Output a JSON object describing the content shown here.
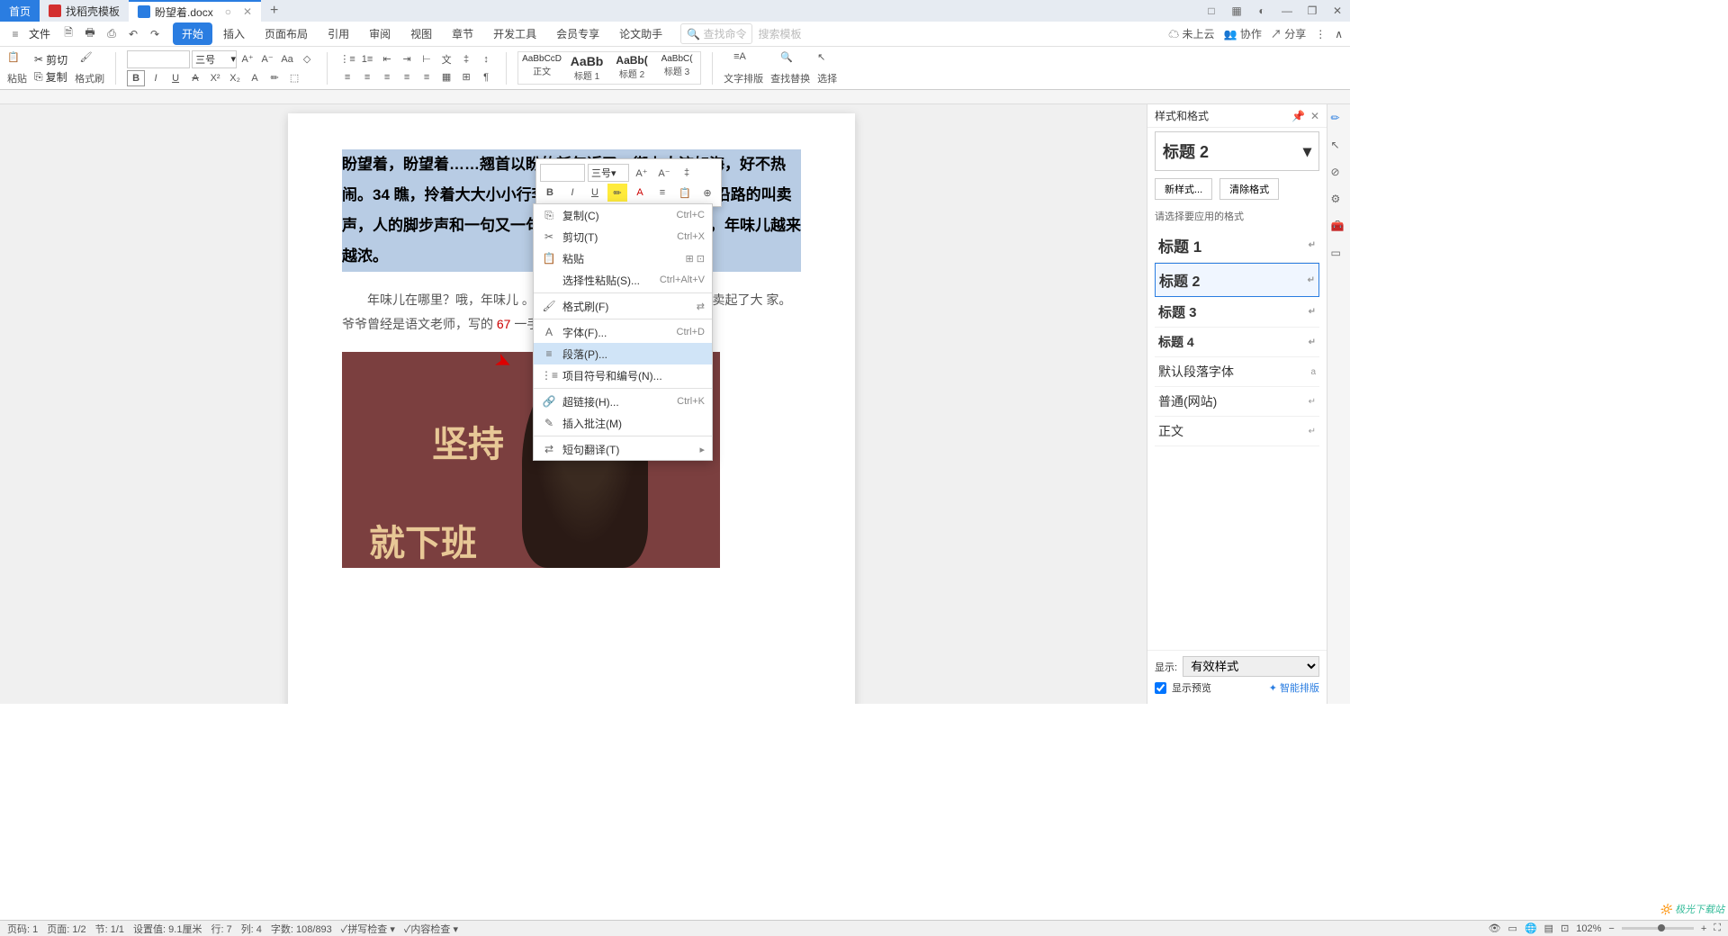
{
  "tabs": {
    "home": "首页",
    "template": "找稻壳模板",
    "doc": "盼望着.docx",
    "plus": "+"
  },
  "window": {
    "close": "✕",
    "max": "❐",
    "min": "—",
    "restore": "□",
    "grid": "▦"
  },
  "file_menu": "文件",
  "qat": [
    "▢",
    "🖶",
    "⎙",
    "↺",
    "↻"
  ],
  "ribbon_tabs": [
    "开始",
    "插入",
    "页面布局",
    "引用",
    "审阅",
    "视图",
    "章节",
    "开发工具",
    "会员专享",
    "论文助手"
  ],
  "search": {
    "cmd": "查找命令",
    "tpl": "搜索模板"
  },
  "top_right": {
    "cloud": "未上云",
    "collab": "协作",
    "share": "分享"
  },
  "ribbon": {
    "paste": "粘贴",
    "copy": "复制",
    "cut": "剪切",
    "brush": "格式刷",
    "font_name": "",
    "font_size": "三号",
    "styles": [
      {
        "preview": "AaBbCcD",
        "name": "正文"
      },
      {
        "preview": "AaBb",
        "name": "标题 1"
      },
      {
        "preview": "AaBb(",
        "name": "标题 2"
      },
      {
        "preview": "AaBbC(",
        "name": "标题 3"
      }
    ],
    "text_layout": "文字排版",
    "find_replace": "查找替换",
    "select": "选择"
  },
  "document": {
    "para1": "盼望着，盼望着……翘首以盼的新年近了。街上人流如海，好不热闹。34 瞧，拎着大大小小行李箱的人在街上奔走相告。沿路的叫卖声，人的脚步声和一句又一句吉祥的交响乐。进入腊月，年味儿越来越浓。",
    "para2_a": "年味儿在哪里？哦，年味儿",
    "para2_b": "。进入腊 ",
    "para2_c": " 月，街上大街小巷开始卖起了大",
    "para2_d": "家。爷爷曾经是语文老师，写的 ",
    "para2_e": " 一手好字",
    "para2_f": "忙活了，亲",
    "red1": "2",
    "red2": "67",
    "img_text1": "坚持",
    "img_text2": "会",
    "img_text3": "就下班"
  },
  "mini": {
    "font": "",
    "size": "三号",
    "A_inc": "A",
    "A_dec": "A"
  },
  "context": [
    {
      "icon": "⎘",
      "label": "复制(C)",
      "shortcut": "Ctrl+C"
    },
    {
      "icon": "✂",
      "label": "剪切(T)",
      "shortcut": "Ctrl+X"
    },
    {
      "icon": "📋",
      "label": "粘贴",
      "shortcut": "",
      "extra": true
    },
    {
      "icon": "",
      "label": "选择性粘贴(S)...",
      "shortcut": "Ctrl+Alt+V"
    },
    {
      "sep": true
    },
    {
      "icon": "🖌",
      "label": "格式刷(F)",
      "shortcut": "",
      "extra2": true
    },
    {
      "sep": true
    },
    {
      "icon": "A",
      "label": "字体(F)...",
      "shortcut": "Ctrl+D"
    },
    {
      "icon": "≡",
      "label": "段落(P)...",
      "shortcut": "",
      "highlight": true
    },
    {
      "icon": "⋮≡",
      "label": "项目符号和编号(N)...",
      "shortcut": ""
    },
    {
      "sep": true
    },
    {
      "icon": "🔗",
      "label": "超链接(H)...",
      "shortcut": "Ctrl+K"
    },
    {
      "icon": "✎",
      "label": "插入批注(M)",
      "shortcut": ""
    },
    {
      "sep": true
    },
    {
      "icon": "⇄",
      "label": "短句翻译(T)",
      "shortcut": "",
      "arrow": true
    }
  ],
  "panel": {
    "title": "样式和格式",
    "current": "标题 2",
    "new_style": "新样式...",
    "clear": "清除格式",
    "hint": "请选择要应用的格式",
    "list": [
      {
        "label": "标题 1",
        "cls": "h1"
      },
      {
        "label": "标题 2",
        "cls": "h2"
      },
      {
        "label": "标题 3",
        "cls": "h3"
      },
      {
        "label": "标题 4",
        "cls": "h4"
      },
      {
        "label": "默认段落字体",
        "cls": ""
      },
      {
        "label": "普通(网站)",
        "cls": ""
      },
      {
        "label": "正文",
        "cls": ""
      }
    ],
    "show_label": "显示:",
    "show_value": "有效样式",
    "preview": "显示预览",
    "smart": "智能排版"
  },
  "status": {
    "page": "页码: 1",
    "pages": "页面: 1/2",
    "section": "节: 1/1",
    "pos": "设置值: 9.1厘米",
    "line": "行: 7",
    "col": "列: 4",
    "words": "字数: 108/893",
    "spell": "拼写检查",
    "content": "内容检查",
    "zoom": "102%"
  },
  "watermark": "极光下载站"
}
